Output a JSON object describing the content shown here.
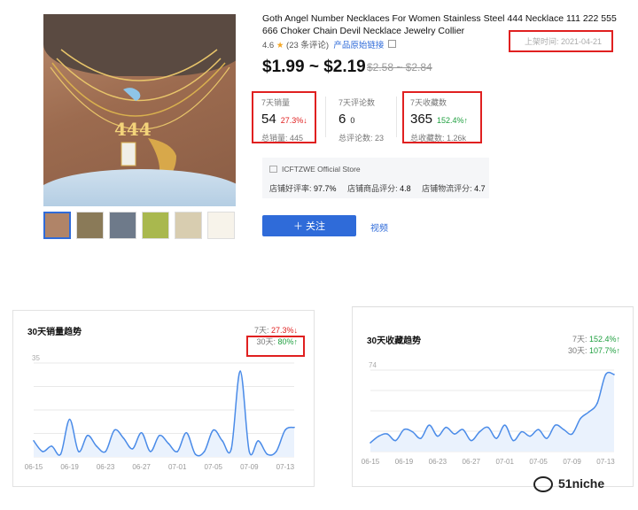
{
  "product": {
    "title": "Goth Angel Number Necklaces For Women Stainless Steel 444 Necklace 111 222 555 666 Choker Chain Devil Necklace Jewelry Collier",
    "rating": "4.6",
    "star": "★",
    "reviews": "(23 条评论)",
    "source_link": "产品原始链接",
    "listed": "上架时间: 2021-04-21",
    "price": "$1.99 ~ $2.19",
    "orig_price": "$2.58 ~ $2.84",
    "main_image_text": "444",
    "thumbnails": 6
  },
  "stats": [
    {
      "label": "7天销量",
      "value": "54",
      "pct": "27.3%↓",
      "pct_color": "red",
      "total": "总销量: 445",
      "boxed": true
    },
    {
      "label": "7天评论数",
      "value": "6",
      "pct": "0",
      "pct_color": "dark",
      "total": "总评论数: 23",
      "boxed": false
    },
    {
      "label": "7天收藏数",
      "value": "365",
      "pct": "152.4%↑",
      "pct_color": "green",
      "total": "总收藏数: 1.26k",
      "boxed": true
    }
  ],
  "store": {
    "name": "ICFTZWE Official Store",
    "m1_label": "店铺好评率:",
    "m1": "97.7%",
    "m2_label": "店铺商品评分:",
    "m2": "4.8",
    "m3_label": "店铺物流评分:",
    "m3": "4.7"
  },
  "actions": {
    "follow": "＋ 关注",
    "video": "视频"
  },
  "sales_panel": {
    "title": "30天销量趋势",
    "d7_label": "7天:",
    "d7": "27.3%↓",
    "d30_label": "30天:",
    "d30": "80%↑"
  },
  "fav_panel": {
    "title": "30天收藏趋势",
    "d7_label": "7天:",
    "d7": "152.4%↑",
    "d30_label": "30天:",
    "d30": "107.7%↑"
  },
  "watermark": "51niche",
  "colors": {
    "accent": "#2f6bd9",
    "up": "#20a040",
    "down": "#e02020",
    "highlight": "#e02020",
    "line": "#4a8be8",
    "fill": "#eaf2fd"
  },
  "chart_data": [
    {
      "type": "line",
      "title": "30天销量趋势",
      "x": [
        "06-15",
        "06-16",
        "06-17",
        "06-18",
        "06-19",
        "06-20",
        "06-21",
        "06-22",
        "06-23",
        "06-24",
        "06-25",
        "06-26",
        "06-27",
        "06-28",
        "06-29",
        "06-30",
        "07-01",
        "07-02",
        "07-03",
        "07-04",
        "07-05",
        "07-06",
        "07-07",
        "07-08",
        "07-09",
        "07-10",
        "07-11",
        "07-12",
        "07-13",
        "07-14"
      ],
      "xticks": [
        "06-15",
        "06-19",
        "06-23",
        "06-27",
        "07-01",
        "07-05",
        "07-09",
        "07-13"
      ],
      "values": [
        6,
        2,
        4,
        1,
        14,
        2,
        8,
        4,
        2,
        10,
        7,
        3,
        9,
        2,
        8,
        5,
        2,
        9,
        1,
        2,
        10,
        6,
        3,
        32,
        2,
        6,
        1,
        2,
        10,
        11
      ],
      "ytick_label": "35",
      "ylim": [
        0,
        35
      ]
    },
    {
      "type": "area",
      "title": "30天收藏趋势",
      "x": [
        "06-15",
        "06-16",
        "06-17",
        "06-18",
        "06-19",
        "06-20",
        "06-21",
        "06-22",
        "06-23",
        "06-24",
        "06-25",
        "06-26",
        "06-27",
        "06-28",
        "06-29",
        "06-30",
        "07-01",
        "07-02",
        "07-03",
        "07-04",
        "07-05",
        "07-06",
        "07-07",
        "07-08",
        "07-09",
        "07-10",
        "07-11",
        "07-12",
        "07-13",
        "07-14"
      ],
      "xticks": [
        "06-15",
        "06-19",
        "06-23",
        "06-27",
        "07-01",
        "07-05",
        "07-09",
        "07-13"
      ],
      "values": [
        8,
        14,
        16,
        10,
        20,
        18,
        12,
        24,
        14,
        22,
        16,
        20,
        10,
        18,
        22,
        12,
        24,
        10,
        18,
        14,
        20,
        12,
        24,
        20,
        16,
        30,
        36,
        44,
        70,
        70
      ],
      "ytick_label": "74",
      "ylim": [
        0,
        74
      ]
    }
  ]
}
